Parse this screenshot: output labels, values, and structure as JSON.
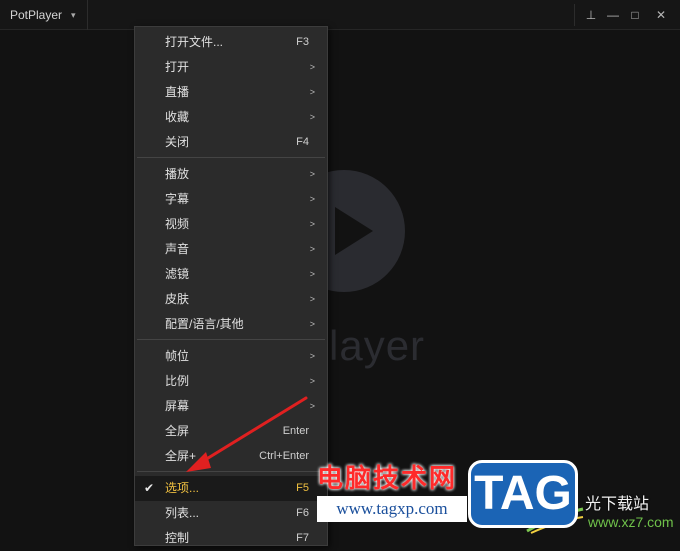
{
  "titlebar": {
    "app_name": "PotPlayer",
    "chevron": "▾",
    "pin_icon": "⊥",
    "minimize_icon": "—",
    "maximize_icon": "□",
    "close_icon": "✕"
  },
  "background": {
    "logo_word": "Player"
  },
  "menu": {
    "items": [
      {
        "label": "打开文件...",
        "shortcut": "F3"
      },
      {
        "label": "打开",
        "shortcut": ">"
      },
      {
        "label": "直播",
        "shortcut": ">"
      },
      {
        "label": "收藏",
        "shortcut": ">"
      },
      {
        "label": "关闭",
        "shortcut": "F4"
      },
      {
        "label": "播放",
        "shortcut": ">"
      },
      {
        "label": "字幕",
        "shortcut": ">"
      },
      {
        "label": "视频",
        "shortcut": ">"
      },
      {
        "label": "声音",
        "shortcut": ">"
      },
      {
        "label": "滤镜",
        "shortcut": ">"
      },
      {
        "label": "皮肤",
        "shortcut": ">"
      },
      {
        "label": "配置/语言/其他",
        "shortcut": ">"
      },
      {
        "label": "帧位",
        "shortcut": ">"
      },
      {
        "label": "比例",
        "shortcut": ">"
      },
      {
        "label": "屏幕",
        "shortcut": ">"
      },
      {
        "label": "全屏",
        "shortcut": "Enter"
      },
      {
        "label": "全屏+",
        "shortcut": "Ctrl+Enter"
      },
      {
        "label": "选项...",
        "shortcut": "F5",
        "checkmark": "✔"
      },
      {
        "label": "列表...",
        "shortcut": "F6"
      },
      {
        "label": "控制",
        "shortcut": "F7"
      }
    ]
  },
  "watermark": {
    "cn_text": "电脑技术网",
    "url": "www.tagxp.com",
    "tag": "TAG",
    "right_text": "光下载站",
    "right_url": "www.xz7.com"
  },
  "colors": {
    "selected_text": "#f0c040",
    "annotation_arrow": "#e02020",
    "menu_bg": "#2b2b2b"
  }
}
